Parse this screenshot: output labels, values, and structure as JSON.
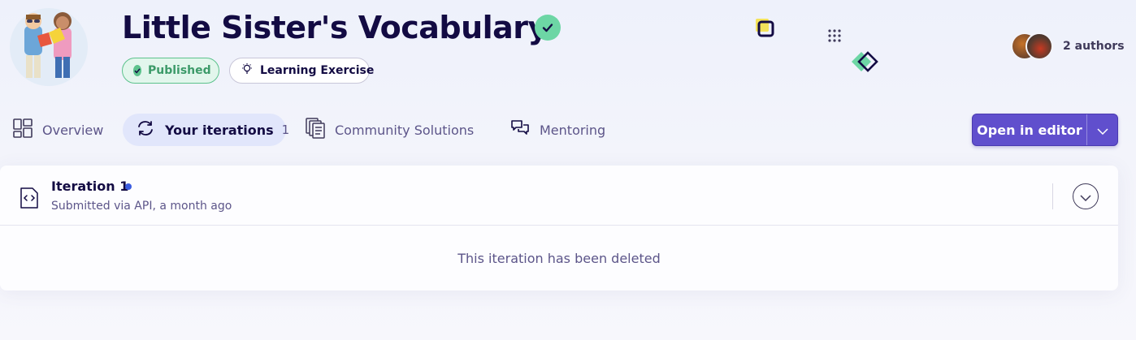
{
  "exercise": {
    "title": "Little Sister's Vocabulary",
    "status_badge": "Published",
    "type_badge": "Learning Exercise"
  },
  "authors": {
    "label": "2 authors"
  },
  "tabs": [
    {
      "label": "Overview",
      "icon": "overview-icon"
    },
    {
      "label": "Your iterations",
      "count": "1",
      "icon": "iterations-icon"
    },
    {
      "label": "Community Solutions",
      "icon": "community-solutions-icon"
    },
    {
      "label": "Mentoring",
      "icon": "mentoring-icon"
    }
  ],
  "editor_button": {
    "label": "Open in editor"
  },
  "iteration": {
    "title": "Iteration 1",
    "subtitle": "Submitted via API, a month ago",
    "deleted_message": "This iteration has been deleted"
  },
  "colors": {
    "accent": "#604fcd",
    "published_green": "#5cc28c",
    "title_text": "#130b43",
    "muted_text": "#5c5589",
    "active_tab_bg": "#e1e6fb"
  }
}
